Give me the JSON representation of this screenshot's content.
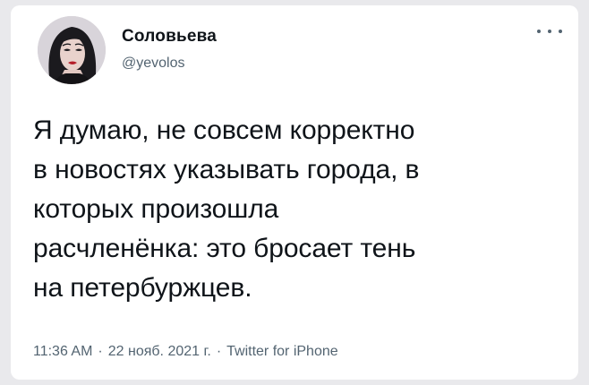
{
  "tweet": {
    "display_name": "Соловьева",
    "handle": "@yevolos",
    "text": "Я думаю, не совсем корректно\nв новостях указывать города, в\nкоторых произошла\nрасчленёнка: это бросает тень\nна петербуржцев.",
    "time": "11:36 AM",
    "date": "22 нояб. 2021 г.",
    "separator": "·",
    "source": "Twitter for iPhone"
  },
  "icons": {
    "avatar": "profile-avatar-image",
    "more": "more-options-icon"
  },
  "colors": {
    "text_primary": "#0f1419",
    "text_secondary": "#536471",
    "background": "#ffffff"
  }
}
